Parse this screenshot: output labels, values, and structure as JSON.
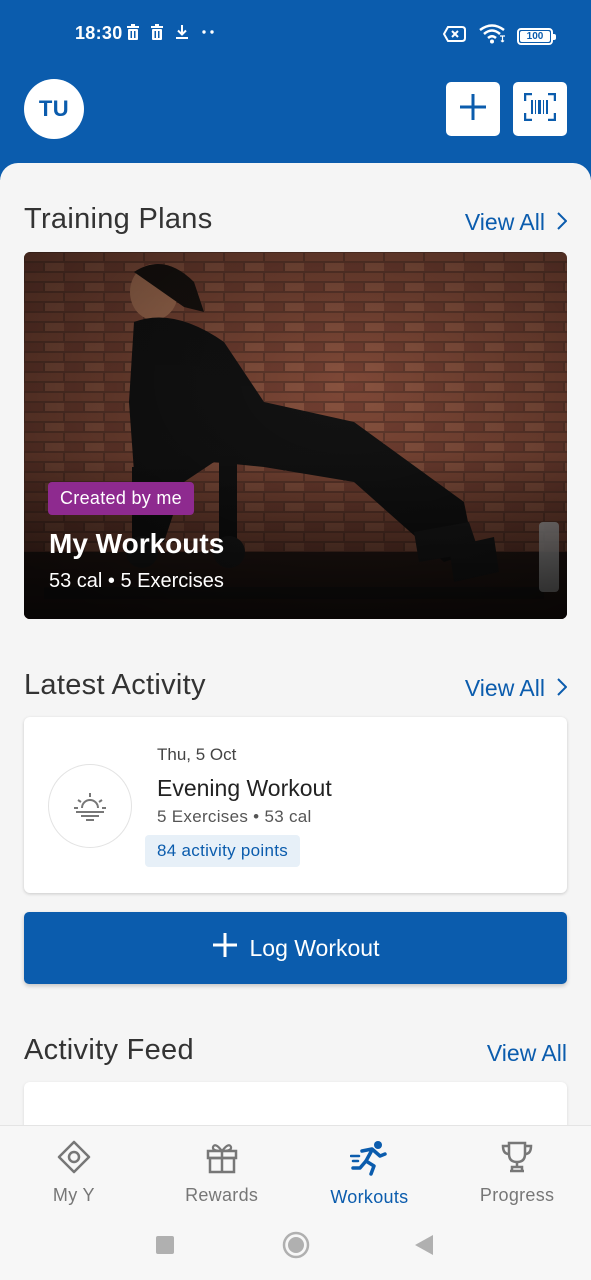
{
  "status_bar": {
    "time": "18:30",
    "battery": "100",
    "icons": [
      "delete-icon",
      "delete-icon",
      "download-icon",
      "more-dots-icon",
      "no-sim-icon",
      "wifi-icon",
      "battery-icon"
    ]
  },
  "header": {
    "avatar_initials": "TU",
    "add_button_icon": "plus-icon",
    "scan_button_icon": "barcode-scan-icon"
  },
  "training_plans": {
    "title": "Training Plans",
    "view_all": "View All",
    "card": {
      "badge": "Created by me",
      "title": "My Workouts",
      "meta": "53 cal • 5 Exercises"
    }
  },
  "latest_activity": {
    "title": "Latest Activity",
    "view_all": "View All",
    "item": {
      "date": "Thu, 5 Oct",
      "title": "Evening Workout",
      "meta": "5 Exercises • 53 cal",
      "points": "84 activity points",
      "icon": "sunset-icon"
    }
  },
  "log_workout": {
    "label": "Log Workout"
  },
  "activity_feed": {
    "title": "Activity Feed",
    "view_all": "View All"
  },
  "bottom_nav": [
    {
      "label": "My Y",
      "icon": "my-y-icon",
      "active": false
    },
    {
      "label": "Rewards",
      "icon": "gift-icon",
      "active": false
    },
    {
      "label": "Workouts",
      "icon": "running-icon",
      "active": true
    },
    {
      "label": "Progress",
      "icon": "trophy-icon",
      "active": false
    }
  ],
  "colors": {
    "brand_blue": "#0b5cad",
    "badge_purple": "#8e2a8f",
    "points_bg": "#e7f0f8"
  }
}
